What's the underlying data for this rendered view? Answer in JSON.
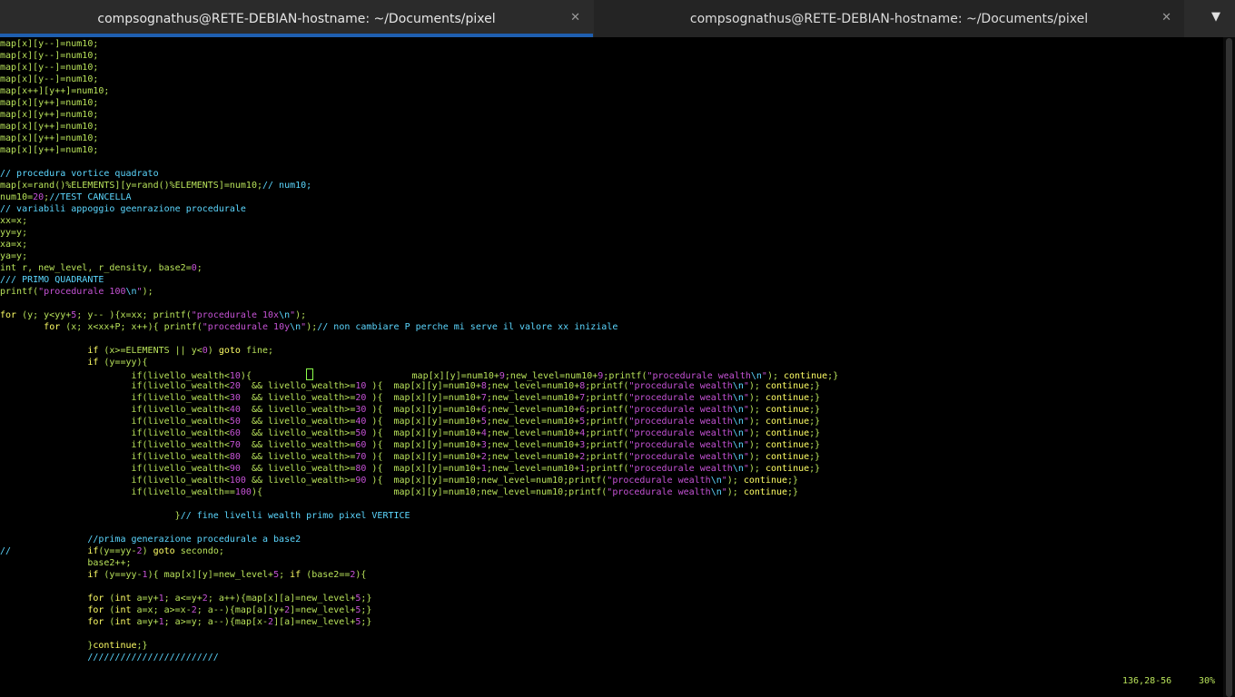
{
  "tabs": [
    {
      "title": "compsognathus@RETE-DEBIAN-hostname: ~/Documents/pixel",
      "active": true
    },
    {
      "title": "compsognathus@RETE-DEBIAN-hostname: ~/Documents/pixel",
      "active": false
    }
  ],
  "tab_close_glyph": "✕",
  "tab_menu_glyph": "▼",
  "status": {
    "position": "136,28-56",
    "percent": "30%"
  },
  "code_lines": [
    [
      [
        "g",
        "map[x][y--]=num10;"
      ]
    ],
    [
      [
        "g",
        "map[x][y--]=num10;"
      ]
    ],
    [
      [
        "g",
        "map[x][y--]=num10;"
      ]
    ],
    [
      [
        "g",
        "map[x][y--]=num10;"
      ]
    ],
    [
      [
        "g",
        "map[x++][y++]=num10;"
      ]
    ],
    [
      [
        "g",
        "map[x][y++]=num10;"
      ]
    ],
    [
      [
        "g",
        "map[x][y++]=num10;"
      ]
    ],
    [
      [
        "g",
        "map[x][y++]=num10;"
      ]
    ],
    [
      [
        "g",
        "map[x][y++]=num10;"
      ]
    ],
    [
      [
        "g",
        "map[x][y++]=num10;"
      ]
    ],
    [],
    [
      [
        "c",
        "// procedura vortice quadrato"
      ]
    ],
    [
      [
        "g",
        "map[x=rand()%ELEMENTS][y=rand()%ELEMENTS]=num10;"
      ],
      [
        "c",
        "// num10;"
      ]
    ],
    [
      [
        "g",
        "num10="
      ],
      [
        "n",
        "20"
      ],
      [
        "g",
        ";"
      ],
      [
        "c",
        "//TEST CANCELLA"
      ]
    ],
    [
      [
        "c",
        "// variabili appoggio geenrazione procedurale"
      ]
    ],
    [
      [
        "g",
        "xx=x;"
      ]
    ],
    [
      [
        "g",
        "yy=y;"
      ]
    ],
    [
      [
        "g",
        "xa=x;"
      ]
    ],
    [
      [
        "g",
        "ya=y;"
      ]
    ],
    [
      [
        "g",
        "int r, new_level, r_density, base2="
      ],
      [
        "n",
        "0"
      ],
      [
        "g",
        ";"
      ]
    ],
    [
      [
        "c",
        "/// PRIMO QUADRANTE"
      ]
    ],
    [
      [
        "g",
        "printf("
      ],
      [
        "s",
        "\"procedurale 100"
      ],
      [
        "c",
        "\\n"
      ],
      [
        "s",
        "\""
      ],
      [
        "g",
        ");"
      ]
    ],
    [],
    [
      [
        "k",
        "for"
      ],
      [
        "g",
        " (y; y<yy+"
      ],
      [
        "n",
        "5"
      ],
      [
        "g",
        "; y-- ){x=xx; printf("
      ],
      [
        "s",
        "\"procedurale 10x"
      ],
      [
        "c",
        "\\n"
      ],
      [
        "s",
        "\""
      ],
      [
        "g",
        ");"
      ]
    ],
    [
      [
        "g",
        "        "
      ],
      [
        "k",
        "for"
      ],
      [
        "g",
        " (x; x<xx+P; x++){ printf("
      ],
      [
        "s",
        "\"procedurale 10y"
      ],
      [
        "c",
        "\\n"
      ],
      [
        "s",
        "\""
      ],
      [
        "g",
        ");"
      ],
      [
        "c",
        "// non cambiare P perche mi serve il valore xx iniziale"
      ]
    ],
    [],
    [
      [
        "g",
        "                "
      ],
      [
        "k",
        "if"
      ],
      [
        "g",
        " (x>=ELEMENTS || y<"
      ],
      [
        "n",
        "0"
      ],
      [
        "g",
        ") "
      ],
      [
        "k",
        "goto"
      ],
      [
        "g",
        " fine;"
      ]
    ],
    [
      [
        "g",
        "                "
      ],
      [
        "k",
        "if"
      ],
      [
        "g",
        " (y==yy){"
      ]
    ],
    [
      [
        "g",
        "                        if(livello_wealth<"
      ],
      [
        "n",
        "10"
      ],
      [
        "g",
        "){          "
      ],
      [
        "cur",
        ""
      ],
      [
        "g",
        "                  map[x][y]=num10+"
      ],
      [
        "n",
        "9"
      ],
      [
        "g",
        ";new_level=num10+"
      ],
      [
        "n",
        "9"
      ],
      [
        "g",
        ";printf("
      ],
      [
        "s",
        "\"procedurale wealth"
      ],
      [
        "c",
        "\\n"
      ],
      [
        "s",
        "\""
      ],
      [
        "g",
        "); "
      ],
      [
        "k",
        "continue"
      ],
      [
        "g",
        ";}"
      ]
    ],
    [
      [
        "g",
        "                        if(livello_wealth<"
      ],
      [
        "n",
        "20"
      ],
      [
        "g",
        "  && livello_wealth>="
      ],
      [
        "n",
        "10"
      ],
      [
        "g",
        " ){  map[x][y]=num10+"
      ],
      [
        "n",
        "8"
      ],
      [
        "g",
        ";new_level=num10+"
      ],
      [
        "n",
        "8"
      ],
      [
        "g",
        ";printf("
      ],
      [
        "s",
        "\"procedurale wealth"
      ],
      [
        "c",
        "\\n"
      ],
      [
        "s",
        "\""
      ],
      [
        "g",
        "); "
      ],
      [
        "k",
        "continue"
      ],
      [
        "g",
        ";}"
      ]
    ],
    [
      [
        "g",
        "                        if(livello_wealth<"
      ],
      [
        "n",
        "30"
      ],
      [
        "g",
        "  && livello_wealth>="
      ],
      [
        "n",
        "20"
      ],
      [
        "g",
        " ){  map[x][y]=num10+"
      ],
      [
        "n",
        "7"
      ],
      [
        "g",
        ";new_level=num10+"
      ],
      [
        "n",
        "7"
      ],
      [
        "g",
        ";printf("
      ],
      [
        "s",
        "\"procedurale wealth"
      ],
      [
        "c",
        "\\n"
      ],
      [
        "s",
        "\""
      ],
      [
        "g",
        "); "
      ],
      [
        "k",
        "continue"
      ],
      [
        "g",
        ";}"
      ]
    ],
    [
      [
        "g",
        "                        if(livello_wealth<"
      ],
      [
        "n",
        "40"
      ],
      [
        "g",
        "  && livello_wealth>="
      ],
      [
        "n",
        "30"
      ],
      [
        "g",
        " ){  map[x][y]=num10+"
      ],
      [
        "n",
        "6"
      ],
      [
        "g",
        ";new_level=num10+"
      ],
      [
        "n",
        "6"
      ],
      [
        "g",
        ";printf("
      ],
      [
        "s",
        "\"procedurale wealth"
      ],
      [
        "c",
        "\\n"
      ],
      [
        "s",
        "\""
      ],
      [
        "g",
        "); "
      ],
      [
        "k",
        "continue"
      ],
      [
        "g",
        ";}"
      ]
    ],
    [
      [
        "g",
        "                        if(livello_wealth<"
      ],
      [
        "n",
        "50"
      ],
      [
        "g",
        "  && livello_wealth>="
      ],
      [
        "n",
        "40"
      ],
      [
        "g",
        " ){  map[x][y]=num10+"
      ],
      [
        "n",
        "5"
      ],
      [
        "g",
        ";new_level=num10+"
      ],
      [
        "n",
        "5"
      ],
      [
        "g",
        ";printf("
      ],
      [
        "s",
        "\"procedurale wealth"
      ],
      [
        "c",
        "\\n"
      ],
      [
        "s",
        "\""
      ],
      [
        "g",
        "); "
      ],
      [
        "k",
        "continue"
      ],
      [
        "g",
        ";}"
      ]
    ],
    [
      [
        "g",
        "                        if(livello_wealth<"
      ],
      [
        "n",
        "60"
      ],
      [
        "g",
        "  && livello_wealth>="
      ],
      [
        "n",
        "50"
      ],
      [
        "g",
        " ){  map[x][y]=num10+"
      ],
      [
        "n",
        "4"
      ],
      [
        "g",
        ";new_level=num10+"
      ],
      [
        "n",
        "4"
      ],
      [
        "g",
        ";printf("
      ],
      [
        "s",
        "\"procedurale wealth"
      ],
      [
        "c",
        "\\n"
      ],
      [
        "s",
        "\""
      ],
      [
        "g",
        "); "
      ],
      [
        "k",
        "continue"
      ],
      [
        "g",
        ";}"
      ]
    ],
    [
      [
        "g",
        "                        if(livello_wealth<"
      ],
      [
        "n",
        "70"
      ],
      [
        "g",
        "  && livello_wealth>="
      ],
      [
        "n",
        "60"
      ],
      [
        "g",
        " ){  map[x][y]=num10+"
      ],
      [
        "n",
        "3"
      ],
      [
        "g",
        ";new_level=num10+"
      ],
      [
        "n",
        "3"
      ],
      [
        "g",
        ";printf("
      ],
      [
        "s",
        "\"procedurale wealth"
      ],
      [
        "c",
        "\\n"
      ],
      [
        "s",
        "\""
      ],
      [
        "g",
        "); "
      ],
      [
        "k",
        "continue"
      ],
      [
        "g",
        ";}"
      ]
    ],
    [
      [
        "g",
        "                        if(livello_wealth<"
      ],
      [
        "n",
        "80"
      ],
      [
        "g",
        "  && livello_wealth>="
      ],
      [
        "n",
        "70"
      ],
      [
        "g",
        " ){  map[x][y]=num10+"
      ],
      [
        "n",
        "2"
      ],
      [
        "g",
        ";new_level=num10+"
      ],
      [
        "n",
        "2"
      ],
      [
        "g",
        ";printf("
      ],
      [
        "s",
        "\"procedurale wealth"
      ],
      [
        "c",
        "\\n"
      ],
      [
        "s",
        "\""
      ],
      [
        "g",
        "); "
      ],
      [
        "k",
        "continue"
      ],
      [
        "g",
        ";}"
      ]
    ],
    [
      [
        "g",
        "                        if(livello_wealth<"
      ],
      [
        "n",
        "90"
      ],
      [
        "g",
        "  && livello_wealth>="
      ],
      [
        "n",
        "80"
      ],
      [
        "g",
        " ){  map[x][y]=num10+"
      ],
      [
        "n",
        "1"
      ],
      [
        "g",
        ";new_level=num10+"
      ],
      [
        "n",
        "1"
      ],
      [
        "g",
        ";printf("
      ],
      [
        "s",
        "\"procedurale wealth"
      ],
      [
        "c",
        "\\n"
      ],
      [
        "s",
        "\""
      ],
      [
        "g",
        "); "
      ],
      [
        "k",
        "continue"
      ],
      [
        "g",
        ";}"
      ]
    ],
    [
      [
        "g",
        "                        if(livello_wealth<"
      ],
      [
        "n",
        "100"
      ],
      [
        "g",
        " && livello_wealth>="
      ],
      [
        "n",
        "90"
      ],
      [
        "g",
        " ){  map[x][y]=num10;new_level=num10;printf("
      ],
      [
        "s",
        "\"procedurale wealth"
      ],
      [
        "c",
        "\\n"
      ],
      [
        "s",
        "\""
      ],
      [
        "g",
        "); "
      ],
      [
        "k",
        "continue"
      ],
      [
        "g",
        ";}"
      ]
    ],
    [
      [
        "g",
        "                        if(livello_wealth=="
      ],
      [
        "n",
        "100"
      ],
      [
        "g",
        "){                        map[x][y]=num10;new_level=num10;printf("
      ],
      [
        "s",
        "\"procedurale wealth"
      ],
      [
        "c",
        "\\n"
      ],
      [
        "s",
        "\""
      ],
      [
        "g",
        "); "
      ],
      [
        "k",
        "continue"
      ],
      [
        "g",
        ";}"
      ]
    ],
    [],
    [
      [
        "g",
        "                                }"
      ],
      [
        "c",
        "// fine livelli wealth primo pixel VERTICE"
      ]
    ],
    [],
    [
      [
        "c",
        "                //prima generazione procedurale a base2"
      ]
    ],
    [
      [
        "c",
        "//"
      ],
      [
        "g",
        "              "
      ],
      [
        "k",
        "if"
      ],
      [
        "g",
        "(y==yy-"
      ],
      [
        "n",
        "2"
      ],
      [
        "g",
        ") "
      ],
      [
        "k",
        "goto"
      ],
      [
        "g",
        " secondo;"
      ]
    ],
    [
      [
        "g",
        "                base2++;"
      ]
    ],
    [
      [
        "g",
        "                "
      ],
      [
        "k",
        "if"
      ],
      [
        "g",
        " (y==yy-"
      ],
      [
        "n",
        "1"
      ],
      [
        "g",
        "){ map[x][y]=new_level+"
      ],
      [
        "n",
        "5"
      ],
      [
        "g",
        "; "
      ],
      [
        "k",
        "if"
      ],
      [
        "g",
        " (base2=="
      ],
      [
        "n",
        "2"
      ],
      [
        "g",
        "){"
      ]
    ],
    [],
    [
      [
        "g",
        "                "
      ],
      [
        "k",
        "for"
      ],
      [
        "g",
        " ("
      ],
      [
        "k",
        "int"
      ],
      [
        "g",
        " a=y+"
      ],
      [
        "n",
        "1"
      ],
      [
        "g",
        "; a<=y+"
      ],
      [
        "n",
        "2"
      ],
      [
        "g",
        "; a++){map[x][a]=new_level+"
      ],
      [
        "n",
        "5"
      ],
      [
        "g",
        ";}"
      ]
    ],
    [
      [
        "g",
        "                "
      ],
      [
        "k",
        "for"
      ],
      [
        "g",
        " ("
      ],
      [
        "k",
        "int"
      ],
      [
        "g",
        " a=x; a>=x-"
      ],
      [
        "n",
        "2"
      ],
      [
        "g",
        "; a--){map[a][y+"
      ],
      [
        "n",
        "2"
      ],
      [
        "g",
        "]=new_level+"
      ],
      [
        "n",
        "5"
      ],
      [
        "g",
        ";}"
      ]
    ],
    [
      [
        "g",
        "                "
      ],
      [
        "k",
        "for"
      ],
      [
        "g",
        " ("
      ],
      [
        "k",
        "int"
      ],
      [
        "g",
        " a=y+"
      ],
      [
        "n",
        "1"
      ],
      [
        "g",
        "; a>=y; a--){map[x-"
      ],
      [
        "n",
        "2"
      ],
      [
        "g",
        "][a]=new_level+"
      ],
      [
        "n",
        "5"
      ],
      [
        "g",
        ";}"
      ]
    ],
    [],
    [
      [
        "g",
        "                }"
      ],
      [
        "k",
        "continue"
      ],
      [
        "g",
        ";}"
      ]
    ],
    [
      [
        "c",
        "                ////////////////////////"
      ]
    ]
  ]
}
